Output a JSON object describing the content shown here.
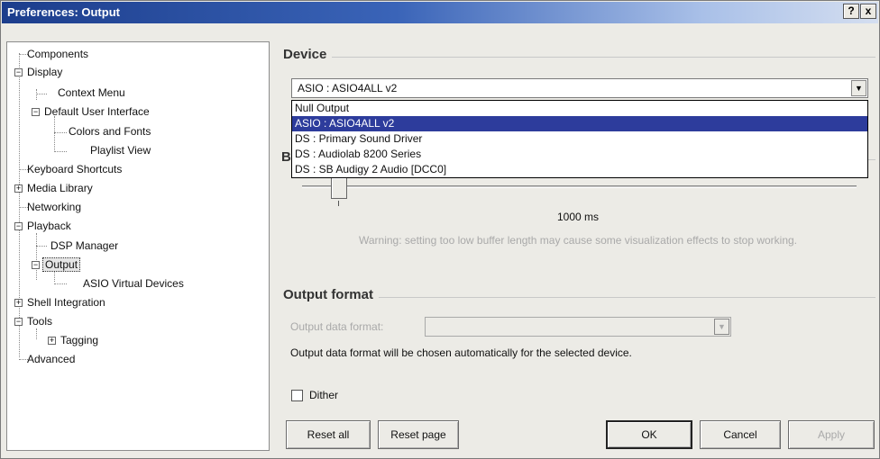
{
  "window": {
    "title": "Preferences: Output",
    "help_button": "?",
    "close_button": "x"
  },
  "tree": {
    "items": [
      {
        "label": "Components"
      },
      {
        "label": "Display",
        "expander": "−"
      },
      {
        "label": "Context Menu"
      },
      {
        "label": "Default User Interface",
        "expander": "−"
      },
      {
        "label": "Colors and Fonts"
      },
      {
        "label": "Playlist View"
      },
      {
        "label": "Keyboard Shortcuts"
      },
      {
        "label": "Media Library",
        "expander": "+"
      },
      {
        "label": "Networking"
      },
      {
        "label": "Playback",
        "expander": "−"
      },
      {
        "label": "DSP Manager"
      },
      {
        "label": "Output",
        "expander": "−",
        "selected": true
      },
      {
        "label": "ASIO Virtual Devices"
      },
      {
        "label": "Shell Integration",
        "expander": "+"
      },
      {
        "label": "Tools",
        "expander": "−"
      },
      {
        "label": "Tagging",
        "expander": "+"
      },
      {
        "label": "Advanced"
      }
    ]
  },
  "device": {
    "section_title": "Device",
    "selected": "ASIO : ASIO4ALL v2",
    "dropdown_arrow": "▼",
    "options": [
      "Null Output",
      "ASIO : ASIO4ALL v2",
      "DS : Primary Sound Driver",
      "DS : Audiolab 8200 Series",
      "DS : SB Audigy 2 Audio [DCC0]"
    ],
    "highlighted_index": 1
  },
  "buffer": {
    "section_letter": "B",
    "value_text": "1000 ms",
    "slider_position": 0.06,
    "warning": "Warning: setting too low buffer length may cause some visualization effects to stop working."
  },
  "output_format": {
    "section_title": "Output format",
    "field_label": "Output data format:",
    "field_value": "",
    "info": "Output data format will be chosen automatically for the selected device."
  },
  "dither": {
    "label": "Dither",
    "checked": false
  },
  "buttons": {
    "reset_all": "Reset all",
    "reset_page": "Reset page",
    "ok": "OK",
    "cancel": "Cancel",
    "apply": "Apply"
  },
  "colors": {
    "title_bar_start": "#1c3d8c",
    "selection": "#2d3c9c",
    "dialog_bg": "#ecebe6",
    "disabled_text": "#a9a9a9"
  }
}
